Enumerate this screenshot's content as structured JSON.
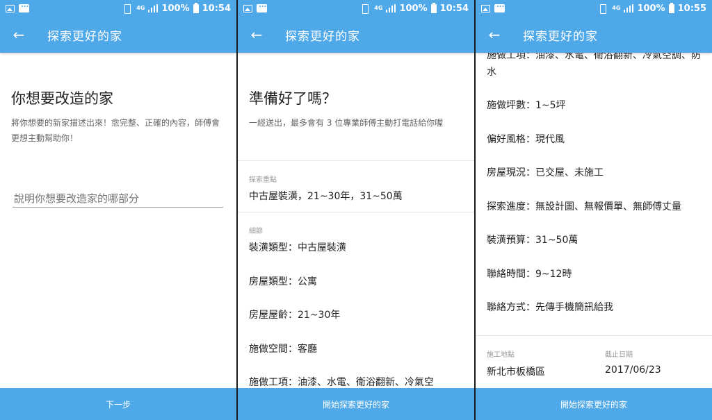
{
  "panels": [
    {
      "status": {
        "battery": "100%",
        "time": "10:54",
        "network": "4G"
      },
      "appbar": {
        "title": "探索更好的家",
        "back_icon": "arrow-left-icon"
      },
      "heading": "你想要改造的家",
      "description": "將你想要的新家描述出來！愈完整、正確的內容，師傅會更想主動幫助你！",
      "input": {
        "placeholder": "說明你想要改造家的哪部分",
        "value": ""
      },
      "button": "下一步"
    },
    {
      "status": {
        "battery": "100%",
        "time": "10:54",
        "network": "4G"
      },
      "appbar": {
        "title": "探索更好的家",
        "back_icon": "arrow-left-icon"
      },
      "heading": "準備好了嗎？",
      "description": "一經送出，最多會有 3 位專業師傅主動打電話給你喔",
      "focus_label": "探索重點",
      "focus_value": "中古屋裝潢，21~30年，31~50萬",
      "details_label": "細節",
      "details": [
        "裝潢類型：中古屋裝潢",
        "房屋類型：公寓",
        "房屋屋齡：21~30年",
        "施做空間：客廳",
        "施做工項：油漆、水電、衛浴翻新、冷氣空"
      ],
      "button": "開始探索更好的家"
    },
    {
      "status": {
        "battery": "100%",
        "time": "10:55",
        "network": "4G"
      },
      "appbar": {
        "title": "探索更好的家",
        "back_icon": "arrow-left-icon"
      },
      "details": [
        "施做工項：油漆、水電、衛浴翻新、冷氣空調、防水",
        "施做坪數：1~5坪",
        "偏好風格：現代風",
        "房屋現況：已交屋、未施工",
        "探索進度：無設計圖、無報價單、無師傅丈量",
        "裝潢預算：31~50萬",
        "聯絡時間：9~12時",
        "聯絡方式：先傳手機簡訊給我"
      ],
      "location_label": "施工地點",
      "location_value": "新北市板橋區",
      "due_label": "截止日期",
      "due_value": "2017/06/23",
      "button": "開始探索更好的家"
    }
  ],
  "colors": {
    "accent": "#4fa8e8",
    "background": "#ffffff",
    "text": "#222222",
    "muted": "#999999"
  }
}
